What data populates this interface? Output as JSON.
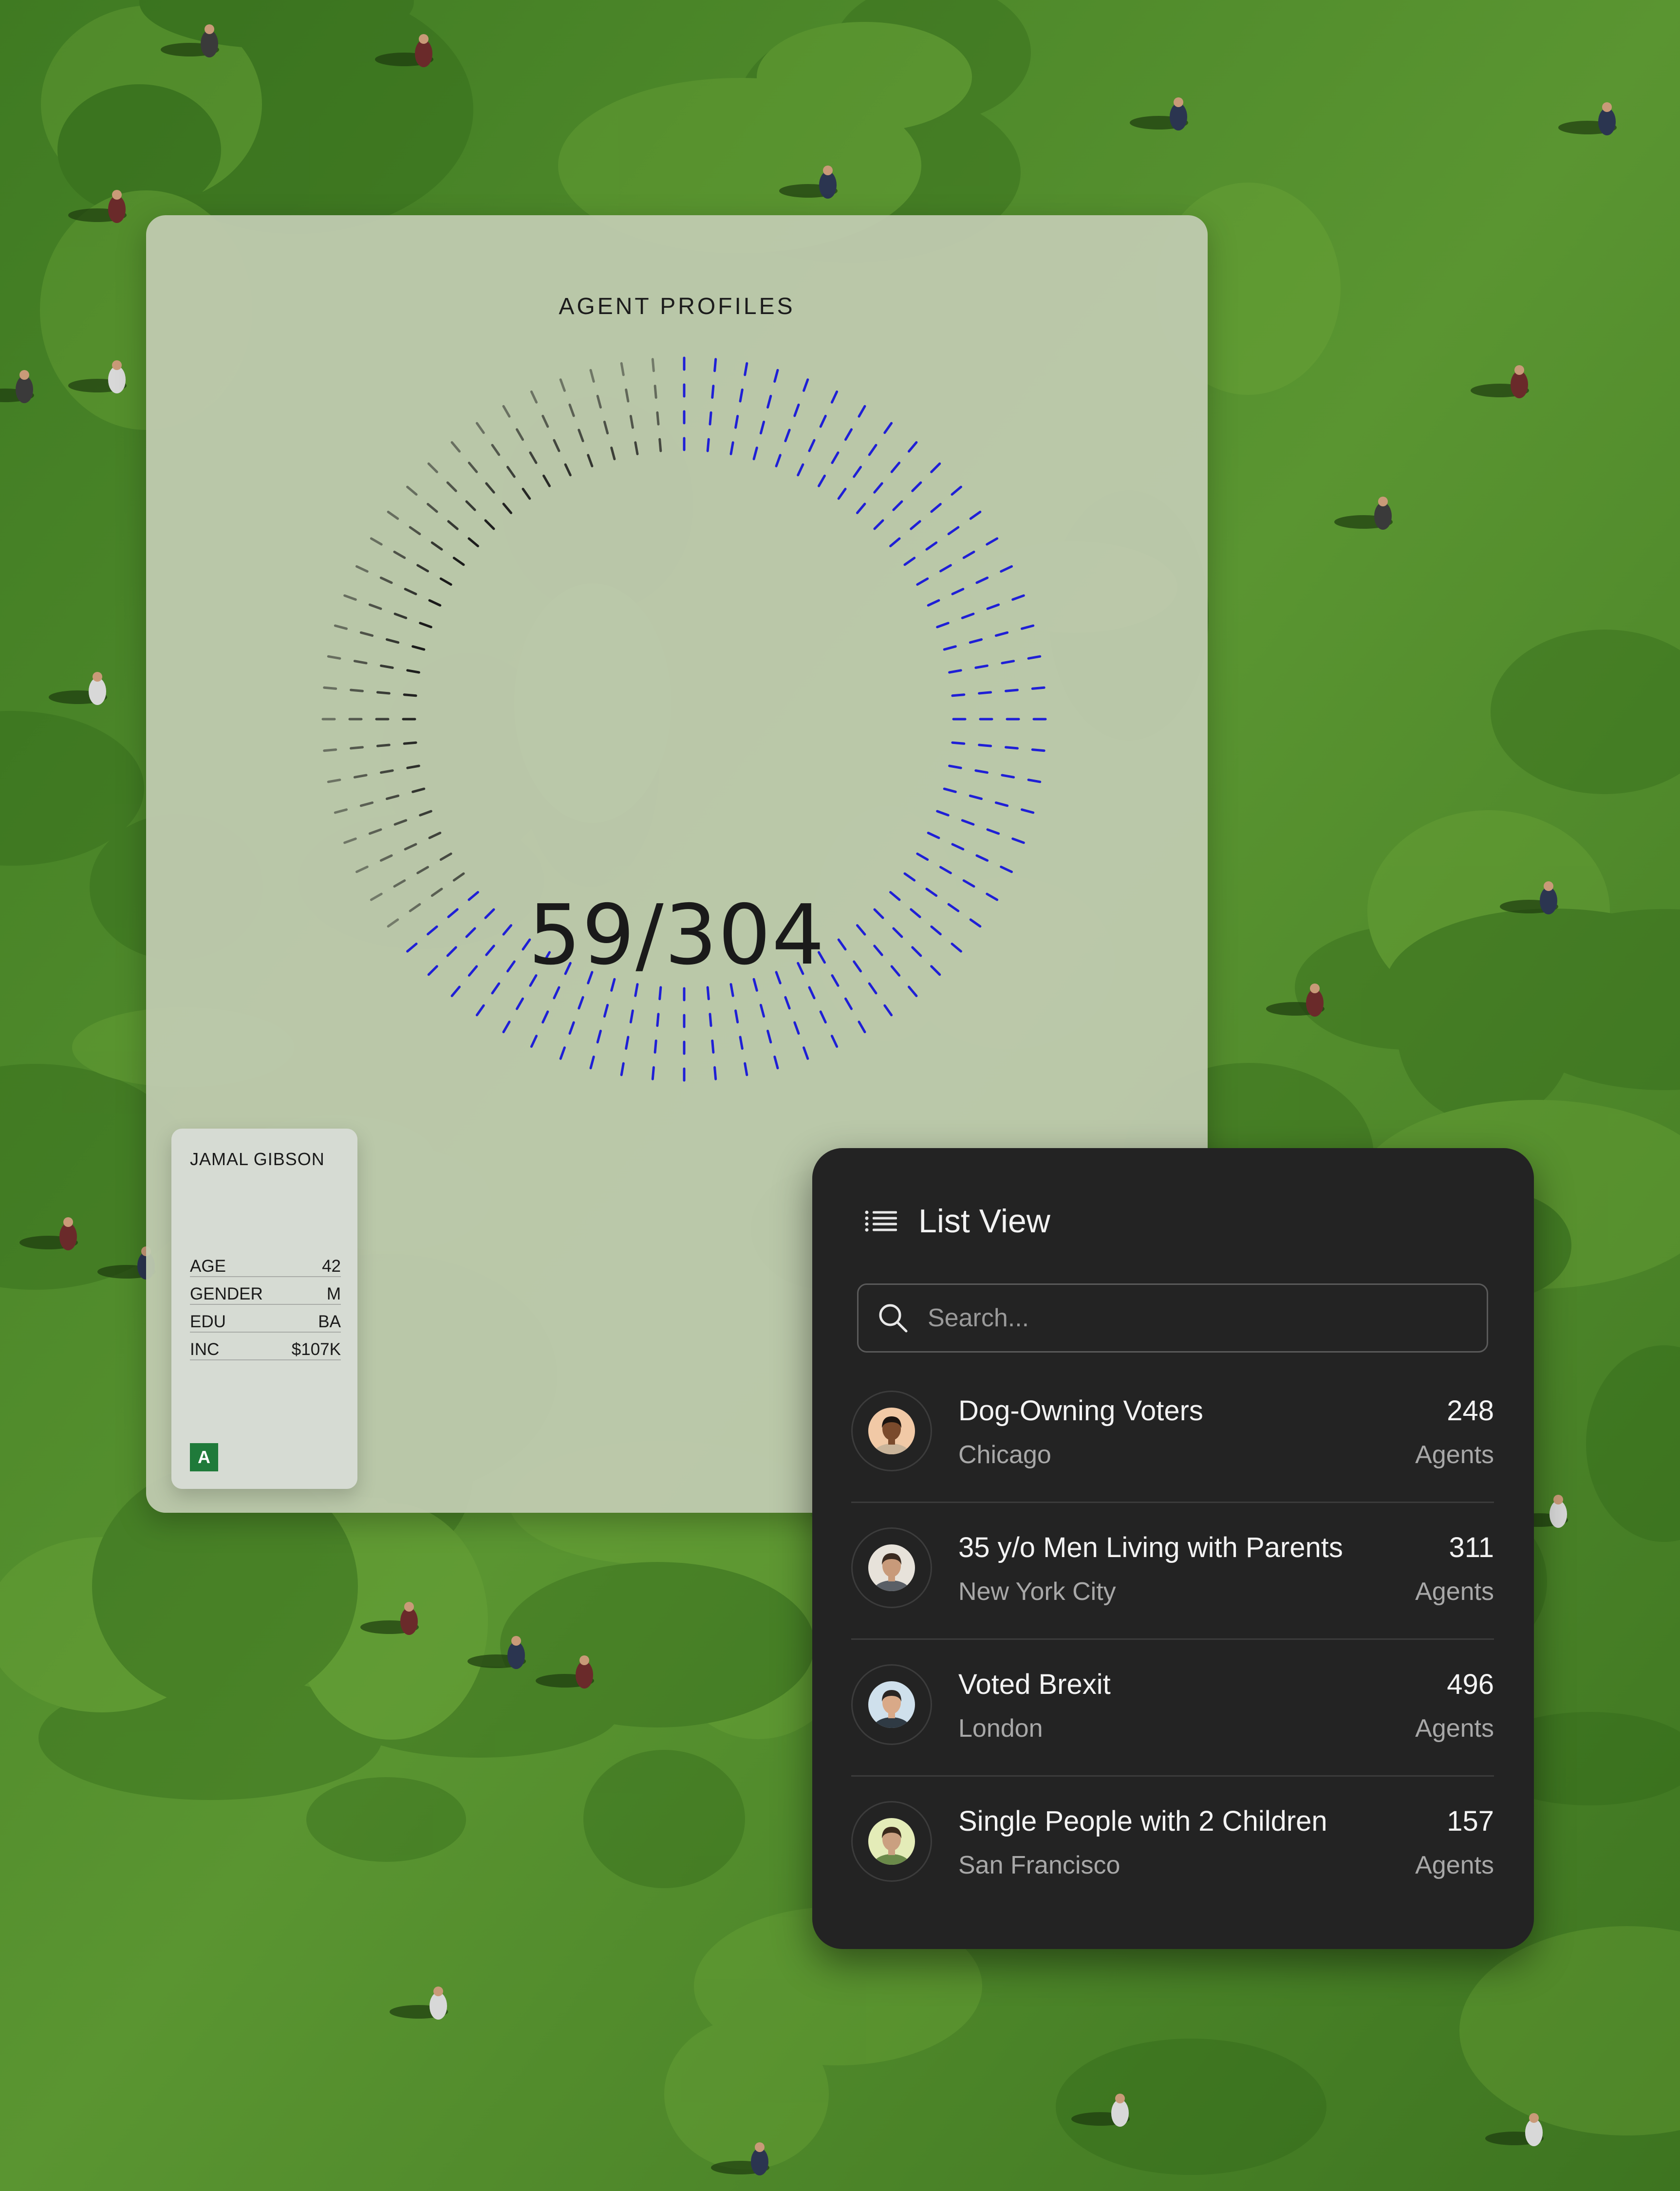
{
  "colors": {
    "grass": "#4f8a2a",
    "panel_bg": "#c0cbb0",
    "ring_active": "#1f1fd6",
    "ring_inactive": "#1a1a1a",
    "list_panel_bg": "#232323",
    "badge_bg": "#1f7a3a"
  },
  "profiles": {
    "title": "AGENT PROFILES",
    "counter": "59/304",
    "progress_fraction": 0.65
  },
  "person_card": {
    "name": "JAMAL GIBSON",
    "attributes": [
      {
        "label": "AGE",
        "value": "42"
      },
      {
        "label": "GENDER",
        "value": "M"
      },
      {
        "label": "EDU",
        "value": "BA"
      },
      {
        "label": "INC",
        "value": "$107K"
      }
    ],
    "badge": "A"
  },
  "list_view": {
    "title": "List View",
    "icon": "list-icon",
    "search": {
      "placeholder": "Search...",
      "value": "",
      "icon": "search-icon"
    },
    "items": [
      {
        "name": "Dog-Owning Voters",
        "city": "Chicago",
        "count": "248",
        "unit": "Agents",
        "avatar": {
          "bg": "#f1c9a6",
          "skin": "#7a4a2c",
          "hair": "#1b1410",
          "shirt": "#c9b49a"
        }
      },
      {
        "name": "35 y/o Men Living with Parents",
        "city": "New York City",
        "count": "311",
        "unit": "Agents",
        "avatar": {
          "bg": "#e7e2da",
          "skin": "#c89a7a",
          "hair": "#3a2a20",
          "shirt": "#5a5f66"
        }
      },
      {
        "name": "Voted Brexit",
        "city": "London",
        "count": "496",
        "unit": "Agents",
        "avatar": {
          "bg": "#cfe0ec",
          "skin": "#d9a988",
          "hair": "#2a2422",
          "shirt": "#2f3a44"
        }
      },
      {
        "name": "Single People with 2 Children",
        "city": "San Francisco",
        "count": "157",
        "unit": "Agents",
        "avatar": {
          "bg": "#e4ecb8",
          "skin": "#caa080",
          "hair": "#3a2a1c",
          "shirt": "#6b8a4a"
        }
      }
    ]
  }
}
